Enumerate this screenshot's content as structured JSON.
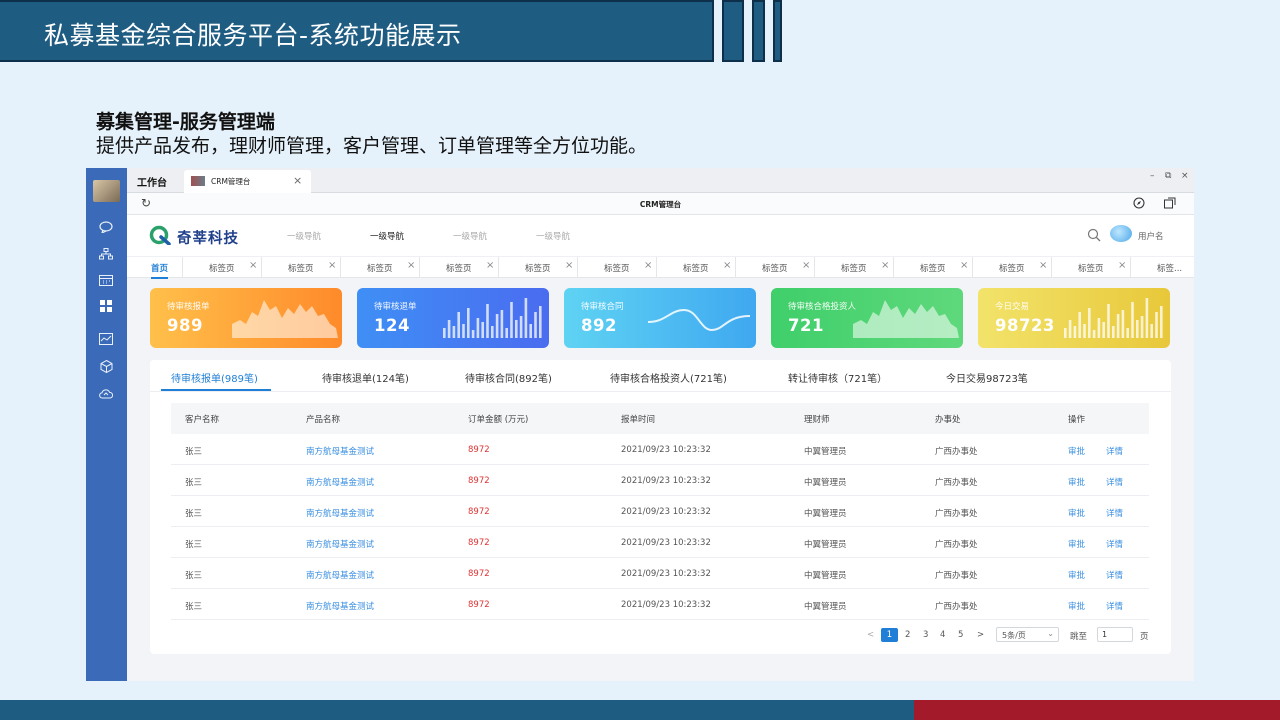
{
  "slide": {
    "title": "私募基金综合服务平台-系统功能展示",
    "section_title": "募集管理-服务管理端",
    "section_desc": "提供产品发布，理财师管理，客户管理、订单管理等全方位功能。",
    "colors": {
      "primary": "#1f5c82",
      "accent_red": "#a31a2b",
      "background": "#e6f2fb"
    }
  },
  "window": {
    "workbench_label": "工作台",
    "tab_label": "CRM管理台",
    "tab_close": "×",
    "address_title": "CRM管理台",
    "controls": {
      "minimize": "–",
      "maximize": "⧉",
      "close": "×"
    }
  },
  "sidebar": {
    "icons": [
      "chat-icon",
      "org-chart-icon",
      "calendar-icon",
      "grid-icon",
      "chart-icon",
      "cube-icon",
      "cloud-icon"
    ]
  },
  "crm": {
    "brand": "奇莘科技",
    "nav": [
      "一级导航",
      "一级导航",
      "一级导航",
      "一级导航"
    ],
    "active_nav_index": 1,
    "username": "用户名",
    "home_tab": "首页",
    "page_tabs": [
      "标签页",
      "标签页",
      "标签页",
      "标签页",
      "标签页",
      "标签页",
      "标签页",
      "标签页",
      "标签页",
      "标签页",
      "标签页",
      "标签页",
      "标签..."
    ],
    "tab_close": "×"
  },
  "stats": [
    {
      "label": "待审核报单",
      "value": "989",
      "color_from": "#ffc04a",
      "color_to": "#ff8a2a",
      "chart": "area"
    },
    {
      "label": "待审核退单",
      "value": "124",
      "color_from": "#3f8ff5",
      "color_to": "#4a6cf0",
      "chart": "bars"
    },
    {
      "label": "待审核合同",
      "value": "892",
      "color_from": "#5fd3f3",
      "color_to": "#3fa8f0",
      "chart": "wave"
    },
    {
      "label": "待审核合格投资人",
      "value": "721",
      "color_from": "#3fcf6a",
      "color_to": "#5fd87c",
      "chart": "area"
    },
    {
      "label": "今日交易",
      "value": "98723",
      "color_from": "#f2e36a",
      "color_to": "#e8c83a",
      "chart": "bars"
    }
  ],
  "panel": {
    "tabs": [
      "待审核报单(989笔)",
      "待审核退单(124笔)",
      "待审核合同(892笔)",
      "待审核合格投资人(721笔)",
      "转让待审核（721笔）",
      "今日交易98723笔"
    ],
    "active_tab_index": 0,
    "columns": [
      "客户名称",
      "产品名称",
      "订单金额 (万元)",
      "报单时间",
      "理财师",
      "办事处",
      "操作"
    ],
    "rows": [
      {
        "customer": "张三",
        "product": "南方航母基金测试",
        "amount": "8972",
        "time": "2021/09/23 10:23:32",
        "advisor": "中翼管理员",
        "office": "广西办事处",
        "approve": "审批",
        "detail": "详情"
      },
      {
        "customer": "张三",
        "product": "南方航母基金测试",
        "amount": "8972",
        "time": "2021/09/23 10:23:32",
        "advisor": "中翼管理员",
        "office": "广西办事处",
        "approve": "审批",
        "detail": "详情"
      },
      {
        "customer": "张三",
        "product": "南方航母基金测试",
        "amount": "8972",
        "time": "2021/09/23 10:23:32",
        "advisor": "中翼管理员",
        "office": "广西办事处",
        "approve": "审批",
        "detail": "详情"
      },
      {
        "customer": "张三",
        "product": "南方航母基金测试",
        "amount": "8972",
        "time": "2021/09/23 10:23:32",
        "advisor": "中翼管理员",
        "office": "广西办事处",
        "approve": "审批",
        "detail": "详情"
      },
      {
        "customer": "张三",
        "product": "南方航母基金测试",
        "amount": "8972",
        "time": "2021/09/23 10:23:32",
        "advisor": "中翼管理员",
        "office": "广西办事处",
        "approve": "审批",
        "detail": "详情"
      },
      {
        "customer": "张三",
        "product": "南方航母基金测试",
        "amount": "8972",
        "time": "2021/09/23 10:23:32",
        "advisor": "中翼管理员",
        "office": "广西办事处",
        "approve": "审批",
        "detail": "详情"
      }
    ]
  },
  "pagination": {
    "prev": "<",
    "next": ">",
    "pages": [
      "1",
      "2",
      "3",
      "4",
      "5"
    ],
    "current": "1",
    "page_size": "5条/页",
    "jump_label": "跳至",
    "jump_value": "1",
    "page_unit": "页"
  }
}
